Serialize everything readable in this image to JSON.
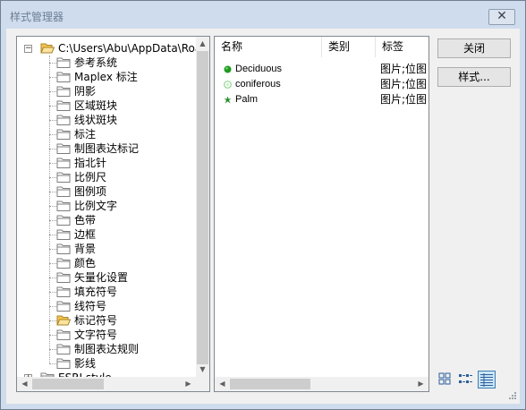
{
  "window": {
    "title": "样式管理器",
    "close_symbol": "✕"
  },
  "tree": {
    "root": {
      "label": "C:\\Users\\Abu\\AppData\\Roamir",
      "expander": "−"
    },
    "children": [
      "参考系统",
      "Maplex 标注",
      "阴影",
      "区域斑块",
      "线状斑块",
      "标注",
      "制图表达标记",
      "指北针",
      "比例尺",
      "图例项",
      "比例文字",
      "色带",
      "边框",
      "背景",
      "颜色",
      "矢量化设置",
      "填充符号",
      "线符号",
      "标记符号",
      "文字符号",
      "制图表达规则",
      "影线"
    ],
    "selected_index": 18,
    "second_root": {
      "label": "ESRI.style",
      "expander": "+"
    }
  },
  "list": {
    "columns": [
      "名称",
      "类别",
      "标签"
    ],
    "items": [
      {
        "name": "Deciduous",
        "tag": "图片;位图",
        "symbol": "round-tree-icon",
        "color": "#1e9a1e"
      },
      {
        "name": "coniferous",
        "tag": "图片;位图",
        "symbol": "light-tree-icon",
        "color": "#7fcf7f"
      },
      {
        "name": "Palm",
        "tag": "图片;位图",
        "symbol": "palm-tree-icon",
        "color": "#2a8a2a"
      }
    ]
  },
  "buttons": {
    "close": "关闭",
    "styles": "样式..."
  },
  "view_modes": [
    "large-icons",
    "list",
    "details"
  ],
  "active_view": "details",
  "colors": {
    "folder": "#f4d37a",
    "folder_open": "#f7c54e",
    "accent": "#3c7fb1"
  }
}
